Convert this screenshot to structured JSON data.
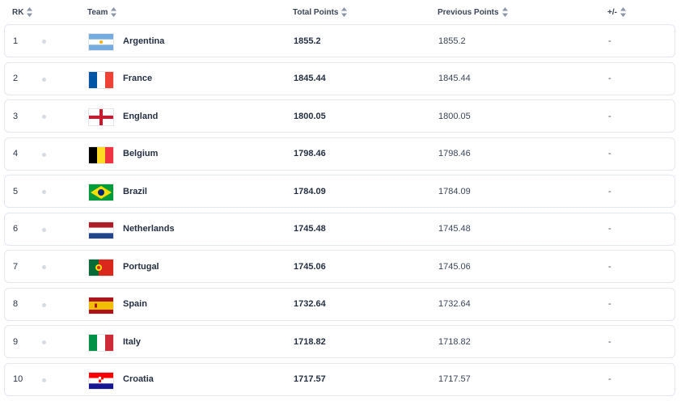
{
  "columns": {
    "rank": "RK",
    "team": "Team",
    "total": "Total Points",
    "previous": "Previous Points",
    "change": "+/-"
  },
  "colors": {
    "sort_icon": "#8a94a6",
    "row_border": "#e3e7ee",
    "dot": "#d7dbe2"
  },
  "rows": [
    {
      "rank": "1",
      "team": "Argentina",
      "flag": "argentina-flag-icon",
      "total": "1855.2",
      "previous": "1855.2",
      "change": "-"
    },
    {
      "rank": "2",
      "team": "France",
      "flag": "france-flag-icon",
      "total": "1845.44",
      "previous": "1845.44",
      "change": "-"
    },
    {
      "rank": "3",
      "team": "England",
      "flag": "england-flag-icon",
      "total": "1800.05",
      "previous": "1800.05",
      "change": "-"
    },
    {
      "rank": "4",
      "team": "Belgium",
      "flag": "belgium-flag-icon",
      "total": "1798.46",
      "previous": "1798.46",
      "change": "-"
    },
    {
      "rank": "5",
      "team": "Brazil",
      "flag": "brazil-flag-icon",
      "total": "1784.09",
      "previous": "1784.09",
      "change": "-"
    },
    {
      "rank": "6",
      "team": "Netherlands",
      "flag": "netherlands-flag-icon",
      "total": "1745.48",
      "previous": "1745.48",
      "change": "-"
    },
    {
      "rank": "7",
      "team": "Portugal",
      "flag": "portugal-flag-icon",
      "total": "1745.06",
      "previous": "1745.06",
      "change": "-"
    },
    {
      "rank": "8",
      "team": "Spain",
      "flag": "spain-flag-icon",
      "total": "1732.64",
      "previous": "1732.64",
      "change": "-"
    },
    {
      "rank": "9",
      "team": "Italy",
      "flag": "italy-flag-icon",
      "total": "1718.82",
      "previous": "1718.82",
      "change": "-"
    },
    {
      "rank": "10",
      "team": "Croatia",
      "flag": "croatia-flag-icon",
      "total": "1717.57",
      "previous": "1717.57",
      "change": "-"
    }
  ]
}
